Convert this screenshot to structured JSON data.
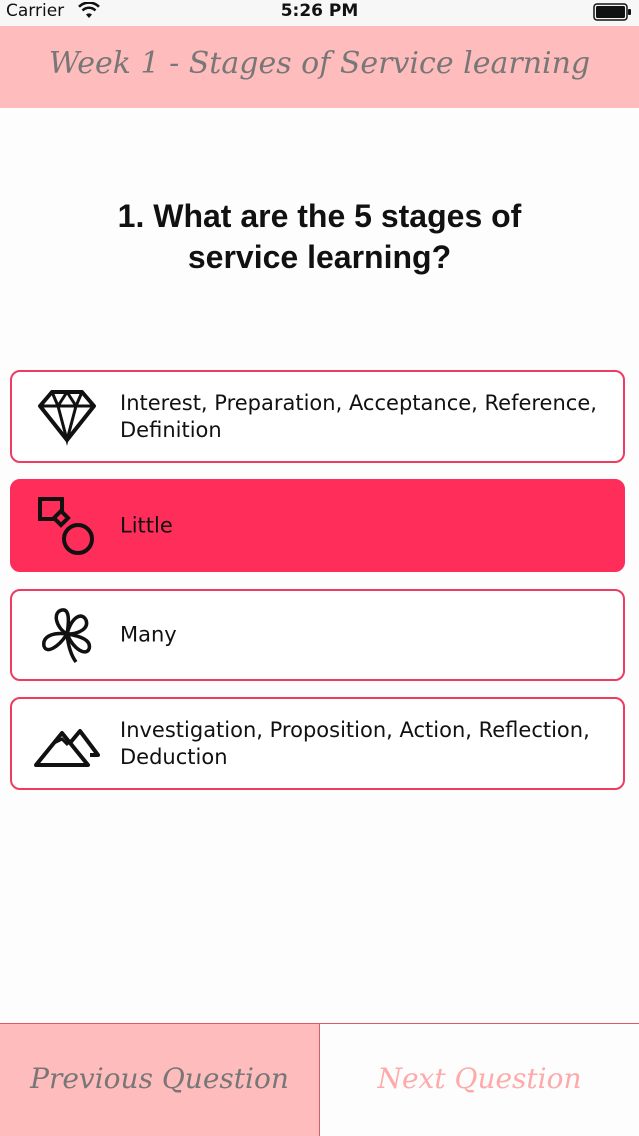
{
  "status_bar": {
    "carrier": "Carrier",
    "time": "5:26 PM"
  },
  "header": {
    "title": "Week 1 - Stages of Service learning"
  },
  "question": {
    "text": "1. What are the 5 stages of service learning?"
  },
  "answers": [
    {
      "label": "Interest, Preparation, Acceptance, Reference, Definition",
      "icon": "diamond-icon",
      "selected": false
    },
    {
      "label": "Little",
      "icon": "shapes-icon",
      "selected": true
    },
    {
      "label": "Many",
      "icon": "clover-icon",
      "selected": false
    },
    {
      "label": "Investigation, Proposition, Action, Reflection, Deduction",
      "icon": "mountain-icon",
      "selected": false
    }
  ],
  "footer": {
    "previous_label": "Previous Question",
    "next_label": "Next Question"
  },
  "colors": {
    "header_bg": "#ffbcbd",
    "accent": "#ff2d5a",
    "border": "#ee3b61",
    "next_text": "#ffaaaa"
  }
}
